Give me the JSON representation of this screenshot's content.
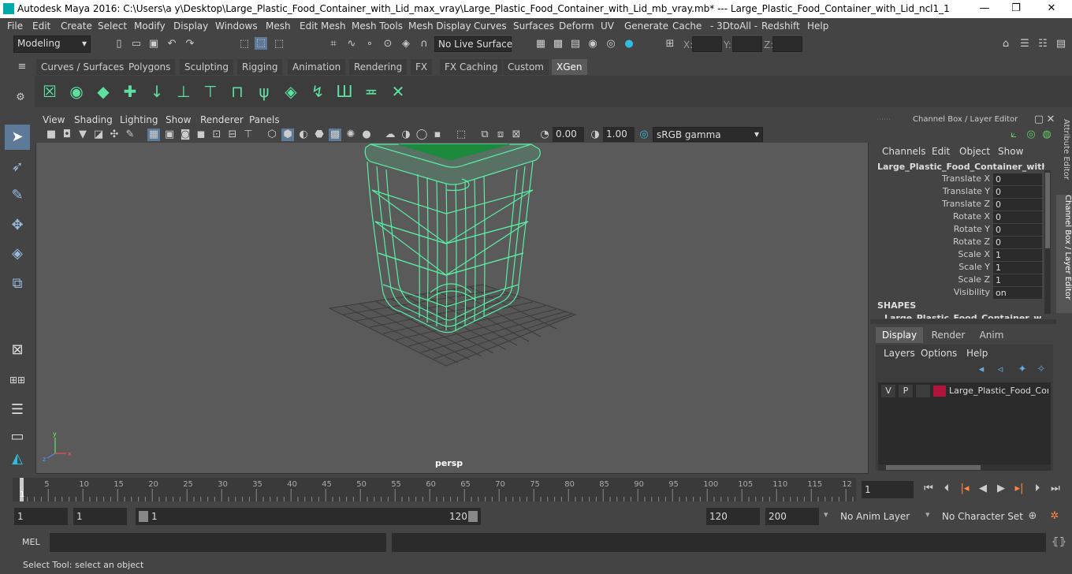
{
  "window": {
    "title": "Autodesk Maya 2016: C:\\Users\\a y\\Desktop\\Large_Plastic_Food_Container_with_Lid_max_vray\\Large_Plastic_Food_Container_with_Lid_mb_vray.mb*   ---   Large_Plastic_Food_Container_with_Lid_ncl1_1",
    "minimize": "—",
    "maximize": "❐",
    "close": "✕"
  },
  "menubar": [
    "File",
    "Edit",
    "Create",
    "Select",
    "Modify",
    "Display",
    "Windows",
    "Mesh",
    "Edit Mesh",
    "Mesh Tools",
    "Mesh Display",
    "Curves",
    "Surfaces",
    "Deform",
    "UV",
    "Generate",
    "Cache",
    "- 3DtoAll -",
    "Redshift",
    "Help"
  ],
  "statusline": {
    "mode": "Modeling",
    "live_surface": "No Live Surface",
    "x_label": "X:",
    "y_label": "Y:",
    "z_label": "Z:"
  },
  "shelf_tabs": [
    "Curves / Surfaces",
    "Polygons",
    "Sculpting",
    "Rigging",
    "Animation",
    "Rendering",
    "FX",
    "FX Caching",
    "Custom",
    "XGen"
  ],
  "active_shelf_tab": "XGen",
  "panel_menu": [
    "View",
    "Shading",
    "Lighting",
    "Show",
    "Renderer",
    "Panels"
  ],
  "panel_tools": {
    "exposure": "0.00",
    "gamma": "1.00",
    "color_space": "sRGB gamma"
  },
  "viewport": {
    "camera_label": "persp",
    "wire_color": "#57f0a4",
    "lid_color": "#1c8a3c"
  },
  "channel_box": {
    "title": "Channel Box / Layer Editor",
    "menu": [
      "Channels",
      "Edit",
      "Object",
      "Show"
    ],
    "object_name": "Large_Plastic_Food_Container_with_Li...",
    "channels": [
      {
        "label": "Translate X",
        "value": "0"
      },
      {
        "label": "Translate Y",
        "value": "0"
      },
      {
        "label": "Translate Z",
        "value": "0"
      },
      {
        "label": "Rotate X",
        "value": "0"
      },
      {
        "label": "Rotate Y",
        "value": "0"
      },
      {
        "label": "Rotate Z",
        "value": "0"
      },
      {
        "label": "Scale X",
        "value": "1"
      },
      {
        "label": "Scale Y",
        "value": "1"
      },
      {
        "label": "Scale Z",
        "value": "1"
      },
      {
        "label": "Visibility",
        "value": "on"
      }
    ],
    "shapes_header": "SHAPES",
    "shapes_item": "Large_Plastic_Food_Container_with...",
    "layer_tabs": [
      "Display",
      "Render",
      "Anim"
    ],
    "layer_menu": [
      "Layers",
      "Options",
      "Help"
    ],
    "layer": {
      "v": "V",
      "p": "P",
      "name": "Large_Plastic_Food_Cont",
      "color": "#b0143c"
    }
  },
  "side_tabs": [
    "Attribute Editor",
    "Channel Box / Layer Editor"
  ],
  "timeline": {
    "ticks": [
      "1",
      "5",
      "10",
      "15",
      "20",
      "25",
      "30",
      "35",
      "40",
      "45",
      "50",
      "55",
      "60",
      "65",
      "70",
      "75",
      "80",
      "85",
      "90",
      "95",
      "100",
      "105",
      "110",
      "115",
      "12"
    ],
    "current_frame": "1"
  },
  "range": {
    "start": "1",
    "playback_start": "1",
    "slider_start": "1",
    "slider_end": "120",
    "playback_end": "120",
    "end": "200",
    "anim_layer": "No Anim Layer",
    "character_set": "No Character Set"
  },
  "mel": {
    "label": "MEL"
  },
  "help_line": "Select Tool: select an object"
}
